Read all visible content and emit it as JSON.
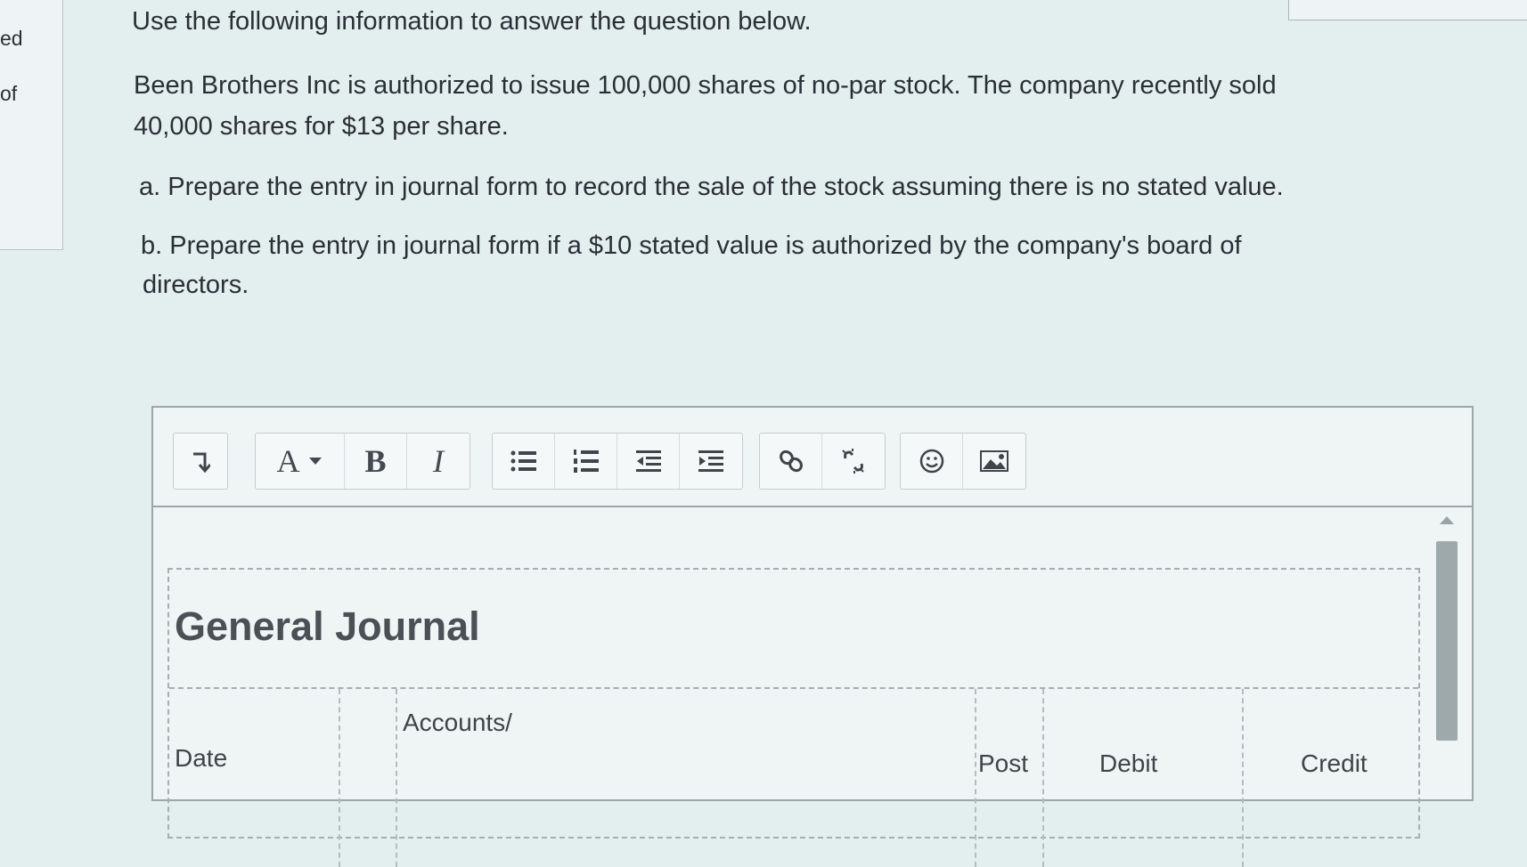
{
  "left_panel": {
    "fragment_1": "ed",
    "fragment_2": "of"
  },
  "question": {
    "intro": "Use the following information to answer the question below.",
    "paragraph_line_1": "Been Brothers Inc is authorized to issue 100,000 shares of no-par stock. The company recently sold",
    "paragraph_line_2": "40,000 shares for $13 per share.",
    "part_a": "a. Prepare the entry in journal form to record the sale of the stock assuming there is no stated value.",
    "part_b_line_1": "b. Prepare the entry in journal form if a $10 stated value is authorized by the company's board of",
    "part_b_line_2": "directors."
  },
  "toolbar": {
    "font_size_label": "A",
    "bold_label": "B",
    "italic_label": "I",
    "icons": [
      "paragraph-format-icon",
      "font-size-icon",
      "bold-icon",
      "italic-icon",
      "bulleted-list-icon",
      "numbered-list-icon",
      "outdent-icon",
      "indent-icon",
      "link-icon",
      "unlink-icon",
      "emoji-icon",
      "image-icon"
    ]
  },
  "journal": {
    "title": "General Journal",
    "columns": {
      "date": "Date",
      "accounts": "Accounts/",
      "post": "Post",
      "debit": "Debit",
      "credit": "Credit"
    }
  }
}
